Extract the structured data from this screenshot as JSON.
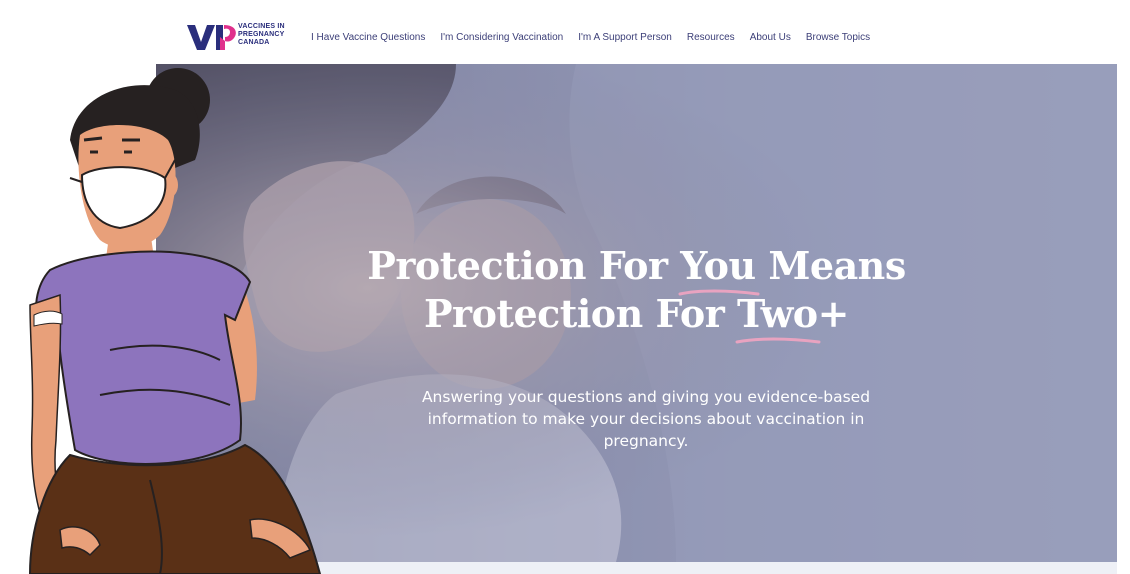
{
  "brand": {
    "logo_lines": [
      "VACCINES IN",
      "PREGNANCY",
      "CANADA"
    ],
    "colors": {
      "navy": "#2a2e7c",
      "pink": "#e0308c",
      "underline": "#e8a3c0"
    }
  },
  "nav": {
    "items": [
      {
        "label": "I Have Vaccine Questions"
      },
      {
        "label": "I'm Considering Vaccination"
      },
      {
        "label": "I'm A Support Person"
      },
      {
        "label": "Resources"
      },
      {
        "label": "About Us"
      },
      {
        "label": "Browse Topics"
      }
    ]
  },
  "hero": {
    "title_line1_a": "Protection For ",
    "title_line1_u": "You",
    "title_line1_b": " Means",
    "title_line2_a": "Protection For ",
    "title_line2_u": "Two",
    "title_line2_b": "+",
    "subtitle": "Answering your questions and giving you evidence-based information to make your decisions about vaccination in pregnancy."
  },
  "illustration": {
    "icon": "pregnant-woman-masked-icon",
    "colors": {
      "shirt": "#8d74bd",
      "pants": "#5a3016",
      "skin": "#e8a07a",
      "hair": "#262121"
    }
  }
}
